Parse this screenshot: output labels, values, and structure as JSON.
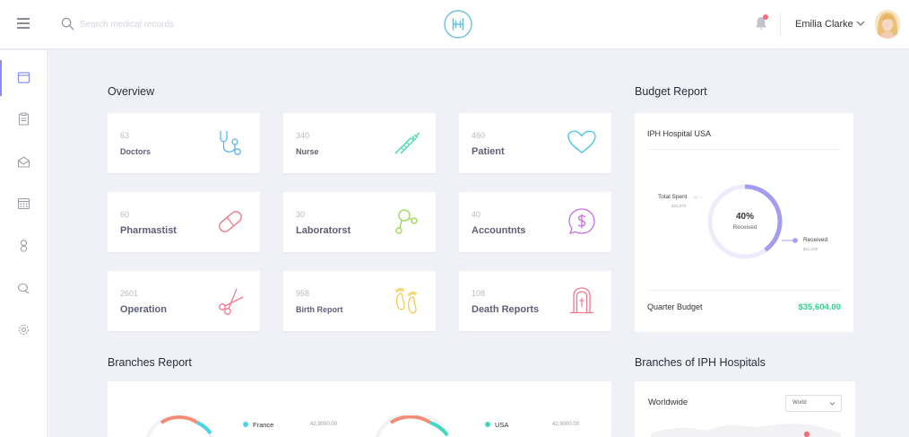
{
  "header": {
    "search_placeholder": "Search medical records",
    "user_name": "Emilia Clarke"
  },
  "overview": {
    "title": "Overview",
    "cards": [
      {
        "value": "63",
        "label": "Doctors"
      },
      {
        "value": "340",
        "label": "Nurse"
      },
      {
        "value": "460",
        "label": "Patient"
      },
      {
        "value": "60",
        "label": "Pharmastist"
      },
      {
        "value": "30",
        "label": "Laboratorst"
      },
      {
        "value": "40",
        "label": "Accountnts"
      },
      {
        "value": "2601",
        "label": "Operation"
      },
      {
        "value": "958",
        "label": "Birth Report"
      },
      {
        "value": "108",
        "label": "Death Reports"
      }
    ]
  },
  "budget": {
    "title": "Budget Report",
    "hospital": "IPH Hospital USA",
    "percent": "40%",
    "percent_label": "Received",
    "received_fraction": 0.4,
    "total_spent_label": "Total Spent",
    "total_spent_value": "$16,570",
    "received_label": "Received",
    "received_value": "$31,430",
    "quarter_label": "Quarter Budget",
    "quarter_amount": "$35,604.00",
    "colors": {
      "ring": "#a49cf0",
      "track": "#eeecfb",
      "amount": "#2bd28f"
    }
  },
  "branches": {
    "title": "Branches Report",
    "items": [
      {
        "name": "France",
        "value": "42,9000.00",
        "color": "#4dd4e6"
      },
      {
        "name": "USA",
        "value": "42,9000.00",
        "color": "#3fd9c0"
      }
    ]
  },
  "world": {
    "title": "Branches of IPH Hospitals",
    "subtitle": "Worldwide",
    "select_value": "World"
  }
}
